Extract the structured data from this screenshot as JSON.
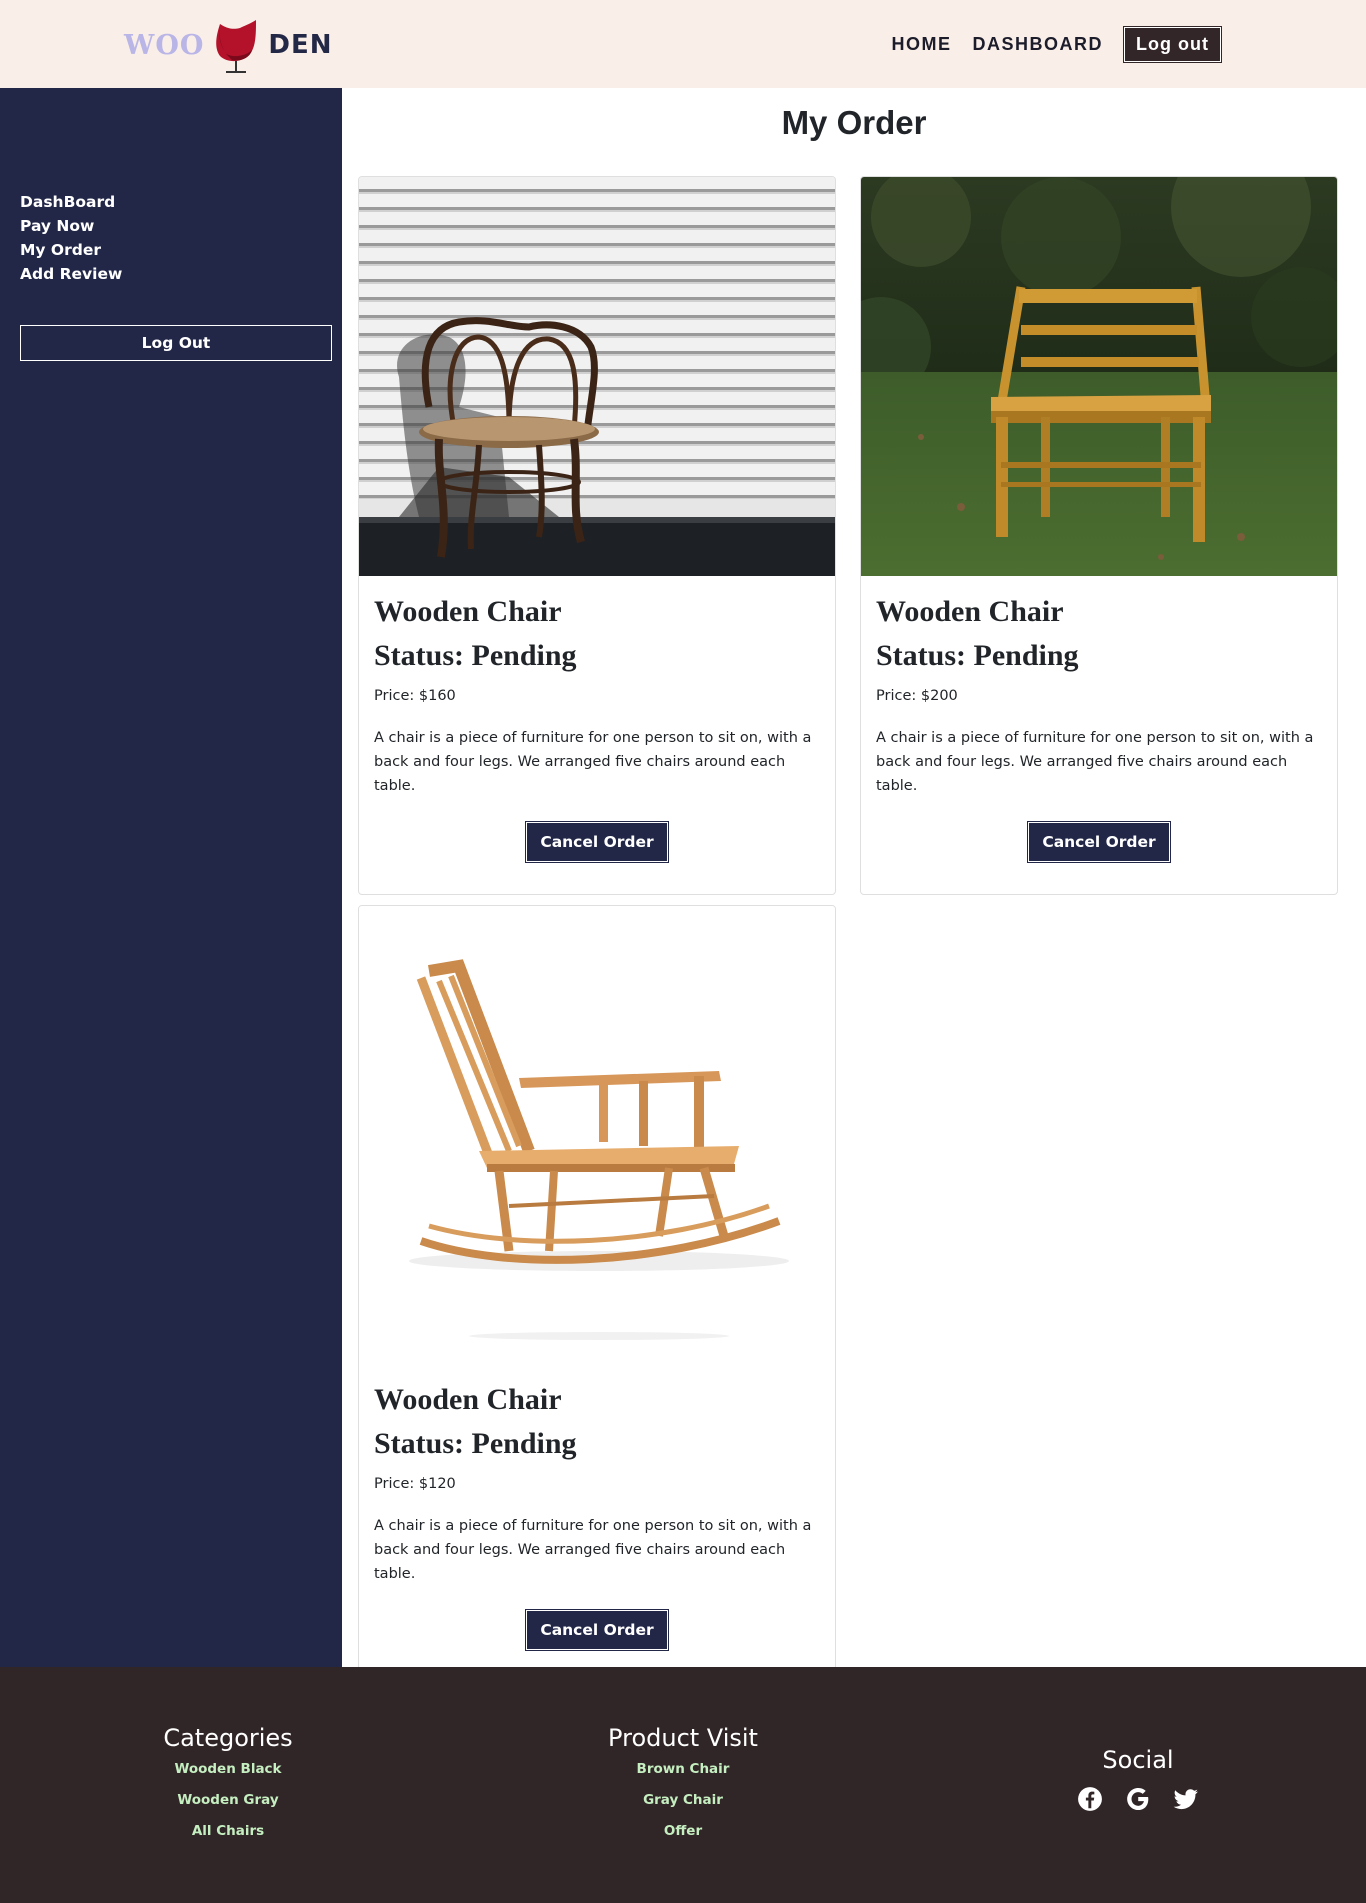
{
  "brand": {
    "left": "WOO",
    "right": "DEN"
  },
  "nav": {
    "home": "HOME",
    "dashboard": "DASHBOARD",
    "logout": "Log out"
  },
  "sidebar": {
    "items": [
      {
        "label": "DashBoard"
      },
      {
        "label": "Pay Now"
      },
      {
        "label": "My Order"
      },
      {
        "label": "Add Review"
      }
    ],
    "logout": "Log Out"
  },
  "page": {
    "title": "My Order"
  },
  "orders": [
    {
      "name": "Wooden Chair",
      "status": "Status: Pending",
      "price": "Price: $160",
      "description": "A chair is a piece of furniture for one person to sit on, with a back and four legs. We arranged five chairs around each table.",
      "button": "Cancel Order",
      "image": "bentwood-chair-photo"
    },
    {
      "name": "Wooden Chair",
      "status": "Status: Pending",
      "price": "Price: $200",
      "description": "A chair is a piece of furniture for one person to sit on, with a back and four legs. We arranged five chairs around each table.",
      "button": "Cancel Order",
      "image": "pine-chair-on-grass-photo"
    },
    {
      "name": "Wooden Chair",
      "status": "Status: Pending",
      "price": "Price: $120",
      "description": "A chair is a piece of furniture for one person to sit on, with a back and four legs. We arranged five chairs around each table.",
      "button": "Cancel Order",
      "image": "rocking-chair-photo"
    }
  ],
  "footer": {
    "categories": {
      "title": "Categories",
      "links": [
        "Wooden Black",
        "Wooden Gray",
        "All Chairs"
      ]
    },
    "product_visit": {
      "title": "Product Visit",
      "links": [
        "Brown Chair",
        "Gray Chair",
        "Offer"
      ]
    },
    "social": {
      "title": "Social",
      "icons": [
        "facebook-icon",
        "google-icon",
        "twitter-icon"
      ]
    }
  },
  "colors": {
    "navbar_bg": "#f9eee8",
    "sidebar_bg": "#222748",
    "footer_bg": "#312627",
    "button_bg": "#222748",
    "logout_bg": "#332629",
    "footer_link": "#c5efc1",
    "logo_light": "#b9b5e6"
  }
}
